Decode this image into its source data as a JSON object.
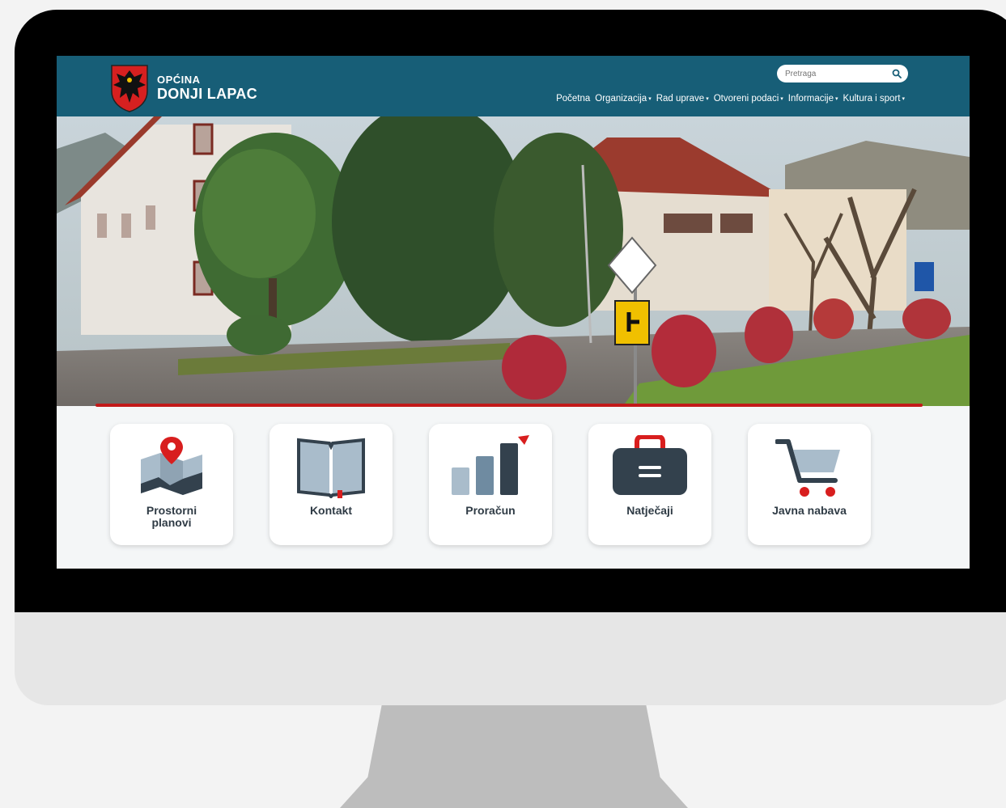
{
  "brand": {
    "line1": "OPĆINA",
    "line2": "DONJI LAPAC"
  },
  "search": {
    "placeholder": "Pretraga",
    "icon": "search-icon"
  },
  "nav": {
    "items": [
      {
        "label": "Početna",
        "dropdown": false
      },
      {
        "label": "Organizacija",
        "dropdown": true
      },
      {
        "label": "Rad uprave",
        "dropdown": true
      },
      {
        "label": "Otvoreni podaci",
        "dropdown": true
      },
      {
        "label": "Informacije",
        "dropdown": true
      },
      {
        "label": "Kultura i sport",
        "dropdown": true
      }
    ],
    "caret": "▾"
  },
  "tiles": [
    {
      "label": "Prostorni planovi",
      "icon": "map-pin-icon"
    },
    {
      "label": "Kontakt",
      "icon": "book-icon"
    },
    {
      "label": "Proračun",
      "icon": "bar-chart-icon"
    },
    {
      "label": "Natječaji",
      "icon": "briefcase-icon"
    },
    {
      "label": "Javna nabava",
      "icon": "shopping-cart-icon"
    }
  ],
  "colors": {
    "header": "#175e77",
    "accent": "#c21a1a",
    "tile_text": "#2f3b45",
    "icon_dark": "#33414d",
    "icon_light": "#a9bccb"
  }
}
